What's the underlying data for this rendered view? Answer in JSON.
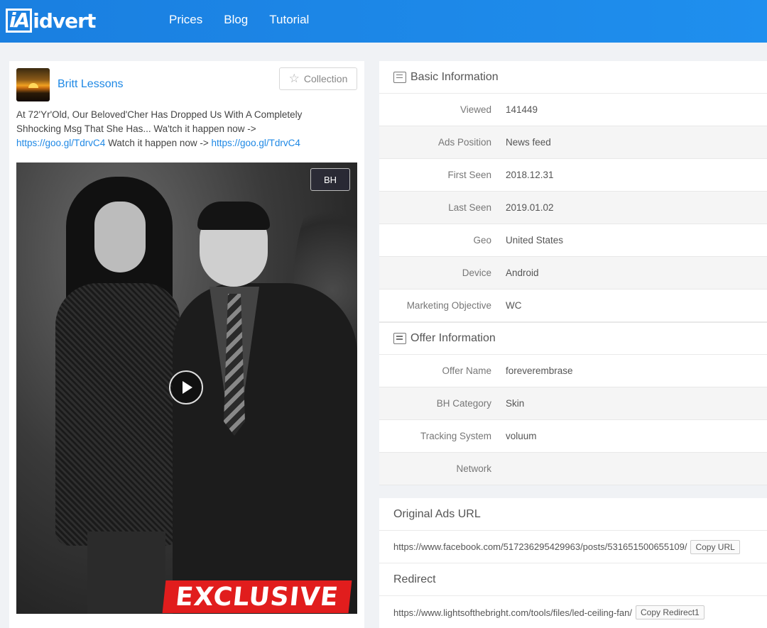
{
  "header": {
    "logo_text": "idvert",
    "logo_mark": "iA",
    "nav": [
      "Prices",
      "Blog",
      "Tutorial"
    ]
  },
  "ad": {
    "author": "Britt Lessons",
    "collection_label": "Collection",
    "text_line1": "At 72'Yr'Old, Our Beloved'Cher Has Dropped Us With A Completely",
    "text_line2": "Shhocking Msg That She Has... Wa'tch it happen now ->",
    "link1": "https://goo.gl/TdrvC4",
    "text_mid": " Watch it happen now -> ",
    "link2": "https://goo.gl/TdrvC4",
    "badge": "BH",
    "overlay_text": "EXCLUSIVE"
  },
  "basic": {
    "title": "Basic Information",
    "rows": [
      {
        "k": "Viewed",
        "v": "141449"
      },
      {
        "k": "Ads Position",
        "v": "News feed"
      },
      {
        "k": "First Seen",
        "v": "2018.12.31"
      },
      {
        "k": "Last Seen",
        "v": "2019.01.02"
      },
      {
        "k": "Geo",
        "v": "United States"
      },
      {
        "k": "Device",
        "v": "Android"
      },
      {
        "k": "Marketing Objective",
        "v": "WC"
      }
    ]
  },
  "offer": {
    "title": "Offer Information",
    "rows": [
      {
        "k": "Offer Name",
        "v": "foreverembrase"
      },
      {
        "k": "BH Category",
        "v": "Skin"
      },
      {
        "k": "Tracking System",
        "v": "voluum"
      },
      {
        "k": "Network",
        "v": ""
      }
    ]
  },
  "urls": {
    "original_title": "Original Ads URL",
    "original_url": "https://www.facebook.com/517236295429963/posts/531651500655109/",
    "copy_url_label": "Copy URL",
    "redirect_title": "Redirect",
    "redirect_url": "https://www.lightsofthebright.com/tools/files/led-ceiling-fan/",
    "copy_redirect_label": "Copy Redirect1"
  }
}
